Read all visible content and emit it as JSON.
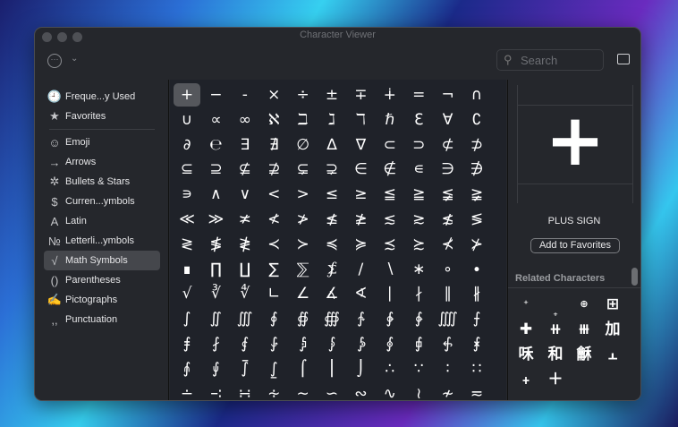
{
  "window": {
    "title": "Character Viewer"
  },
  "toolbar": {
    "search_placeholder": "Search"
  },
  "sidebar": {
    "items": [
      {
        "label": "Freque...y Used",
        "icon": "🕘"
      },
      {
        "label": "Favorites",
        "icon": "★"
      },
      {
        "label": "Emoji",
        "icon": "☺"
      },
      {
        "label": "Arrows",
        "icon": "→"
      },
      {
        "label": "Bullets & Stars",
        "icon": "✲"
      },
      {
        "label": "Curren...ymbols",
        "icon": "$"
      },
      {
        "label": "Latin",
        "icon": "A"
      },
      {
        "label": "Letterli...ymbols",
        "icon": "№"
      },
      {
        "label": "Math Symbols",
        "icon": "√"
      },
      {
        "label": "Parentheses",
        "icon": "()"
      },
      {
        "label": "Pictographs",
        "icon": "✍"
      },
      {
        "label": "Punctuation",
        "icon": ",,"
      }
    ],
    "selected": "Math Symbols"
  },
  "grid": {
    "rows": [
      [
        "+",
        "−",
        "-",
        "×",
        "÷",
        "±",
        "∓",
        "∔",
        "=",
        "¬",
        "∩"
      ],
      [
        "∪",
        "∝",
        "∞",
        "ℵ",
        "ℶ",
        "ℷ",
        "ℸ",
        "ℏ",
        "ℇ",
        "∀",
        "∁"
      ],
      [
        "∂",
        "℮",
        "∃",
        "∄",
        "∅",
        "∆",
        "∇",
        "⊂",
        "⊃",
        "⊄",
        "⊅"
      ],
      [
        "⊆",
        "⊇",
        "⊈",
        "⊉",
        "⊊",
        "⊋",
        "∈",
        "∉",
        "∊",
        "∋",
        "∌"
      ],
      [
        "∍",
        "∧",
        "∨",
        "<",
        ">",
        "≤",
        "≥",
        "≦",
        "≧",
        "≨",
        "≩"
      ],
      [
        "≪",
        "≫",
        "≭",
        "≮",
        "≯",
        "≰",
        "≱",
        "≲",
        "≳",
        "≴",
        "≶"
      ],
      [
        "≷",
        "≸",
        "≹",
        "≺",
        "≻",
        "≼",
        "≽",
        "≾",
        "≿",
        "⊀",
        "⊁"
      ],
      [
        "∎",
        "∏",
        "∐",
        "∑",
        "⅀",
        "⨋",
        "∕",
        "∖",
        "∗",
        "∘",
        "∙"
      ],
      [
        "√",
        "∛",
        "∜",
        "∟",
        "∠",
        "∡",
        "∢",
        "∣",
        "∤",
        "∥",
        "∦"
      ],
      [
        "∫",
        "∬",
        "∭",
        "∮",
        "∯",
        "∰",
        "∱",
        "∲",
        "∳",
        "⨌",
        "⨍"
      ],
      [
        "⨎",
        "⨏",
        "⨐",
        "⨑",
        "⨒",
        "⨓",
        "⨔",
        "⨕",
        "⨖",
        "⨗",
        "⨘"
      ],
      [
        "⨙",
        "⨚",
        "⨛",
        "⨜",
        "⌠",
        "⎮",
        "⌡",
        "∴",
        "∵",
        "∶",
        "∷"
      ],
      [
        "∸",
        "∹",
        "∺",
        "∻",
        "∼",
        "∽",
        "∾",
        "∿",
        "≀",
        "≁",
        "≂"
      ]
    ],
    "selected": "+"
  },
  "detail": {
    "character": "+",
    "name": "PLUS SIGN",
    "add_favorites_label": "Add to Favorites",
    "related_heading": "Related Characters",
    "related": [
      "⁺",
      "₊",
      "⊕",
      "⊞",
      "✚",
      "⧺",
      "⧻",
      "加",
      "咊",
      "和",
      "龢",
      "⫠",
      "﹢",
      "＋"
    ]
  }
}
